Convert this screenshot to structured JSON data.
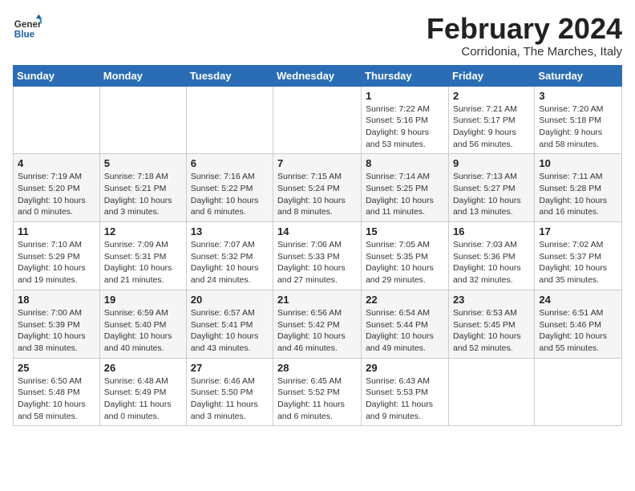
{
  "header": {
    "logo_general": "General",
    "logo_blue": "Blue",
    "main_title": "February 2024",
    "subtitle": "Corridonia, The Marches, Italy"
  },
  "calendar": {
    "weekdays": [
      "Sunday",
      "Monday",
      "Tuesday",
      "Wednesday",
      "Thursday",
      "Friday",
      "Saturday"
    ],
    "weeks": [
      [
        {
          "day": "",
          "info": ""
        },
        {
          "day": "",
          "info": ""
        },
        {
          "day": "",
          "info": ""
        },
        {
          "day": "",
          "info": ""
        },
        {
          "day": "1",
          "info": "Sunrise: 7:22 AM\nSunset: 5:16 PM\nDaylight: 9 hours\nand 53 minutes."
        },
        {
          "day": "2",
          "info": "Sunrise: 7:21 AM\nSunset: 5:17 PM\nDaylight: 9 hours\nand 56 minutes."
        },
        {
          "day": "3",
          "info": "Sunrise: 7:20 AM\nSunset: 5:18 PM\nDaylight: 9 hours\nand 58 minutes."
        }
      ],
      [
        {
          "day": "4",
          "info": "Sunrise: 7:19 AM\nSunset: 5:20 PM\nDaylight: 10 hours\nand 0 minutes."
        },
        {
          "day": "5",
          "info": "Sunrise: 7:18 AM\nSunset: 5:21 PM\nDaylight: 10 hours\nand 3 minutes."
        },
        {
          "day": "6",
          "info": "Sunrise: 7:16 AM\nSunset: 5:22 PM\nDaylight: 10 hours\nand 6 minutes."
        },
        {
          "day": "7",
          "info": "Sunrise: 7:15 AM\nSunset: 5:24 PM\nDaylight: 10 hours\nand 8 minutes."
        },
        {
          "day": "8",
          "info": "Sunrise: 7:14 AM\nSunset: 5:25 PM\nDaylight: 10 hours\nand 11 minutes."
        },
        {
          "day": "9",
          "info": "Sunrise: 7:13 AM\nSunset: 5:27 PM\nDaylight: 10 hours\nand 13 minutes."
        },
        {
          "day": "10",
          "info": "Sunrise: 7:11 AM\nSunset: 5:28 PM\nDaylight: 10 hours\nand 16 minutes."
        }
      ],
      [
        {
          "day": "11",
          "info": "Sunrise: 7:10 AM\nSunset: 5:29 PM\nDaylight: 10 hours\nand 19 minutes."
        },
        {
          "day": "12",
          "info": "Sunrise: 7:09 AM\nSunset: 5:31 PM\nDaylight: 10 hours\nand 21 minutes."
        },
        {
          "day": "13",
          "info": "Sunrise: 7:07 AM\nSunset: 5:32 PM\nDaylight: 10 hours\nand 24 minutes."
        },
        {
          "day": "14",
          "info": "Sunrise: 7:06 AM\nSunset: 5:33 PM\nDaylight: 10 hours\nand 27 minutes."
        },
        {
          "day": "15",
          "info": "Sunrise: 7:05 AM\nSunset: 5:35 PM\nDaylight: 10 hours\nand 29 minutes."
        },
        {
          "day": "16",
          "info": "Sunrise: 7:03 AM\nSunset: 5:36 PM\nDaylight: 10 hours\nand 32 minutes."
        },
        {
          "day": "17",
          "info": "Sunrise: 7:02 AM\nSunset: 5:37 PM\nDaylight: 10 hours\nand 35 minutes."
        }
      ],
      [
        {
          "day": "18",
          "info": "Sunrise: 7:00 AM\nSunset: 5:39 PM\nDaylight: 10 hours\nand 38 minutes."
        },
        {
          "day": "19",
          "info": "Sunrise: 6:59 AM\nSunset: 5:40 PM\nDaylight: 10 hours\nand 40 minutes."
        },
        {
          "day": "20",
          "info": "Sunrise: 6:57 AM\nSunset: 5:41 PM\nDaylight: 10 hours\nand 43 minutes."
        },
        {
          "day": "21",
          "info": "Sunrise: 6:56 AM\nSunset: 5:42 PM\nDaylight: 10 hours\nand 46 minutes."
        },
        {
          "day": "22",
          "info": "Sunrise: 6:54 AM\nSunset: 5:44 PM\nDaylight: 10 hours\nand 49 minutes."
        },
        {
          "day": "23",
          "info": "Sunrise: 6:53 AM\nSunset: 5:45 PM\nDaylight: 10 hours\nand 52 minutes."
        },
        {
          "day": "24",
          "info": "Sunrise: 6:51 AM\nSunset: 5:46 PM\nDaylight: 10 hours\nand 55 minutes."
        }
      ],
      [
        {
          "day": "25",
          "info": "Sunrise: 6:50 AM\nSunset: 5:48 PM\nDaylight: 10 hours\nand 58 minutes."
        },
        {
          "day": "26",
          "info": "Sunrise: 6:48 AM\nSunset: 5:49 PM\nDaylight: 11 hours\nand 0 minutes."
        },
        {
          "day": "27",
          "info": "Sunrise: 6:46 AM\nSunset: 5:50 PM\nDaylight: 11 hours\nand 3 minutes."
        },
        {
          "day": "28",
          "info": "Sunrise: 6:45 AM\nSunset: 5:52 PM\nDaylight: 11 hours\nand 6 minutes."
        },
        {
          "day": "29",
          "info": "Sunrise: 6:43 AM\nSunset: 5:53 PM\nDaylight: 11 hours\nand 9 minutes."
        },
        {
          "day": "",
          "info": ""
        },
        {
          "day": "",
          "info": ""
        }
      ]
    ]
  }
}
